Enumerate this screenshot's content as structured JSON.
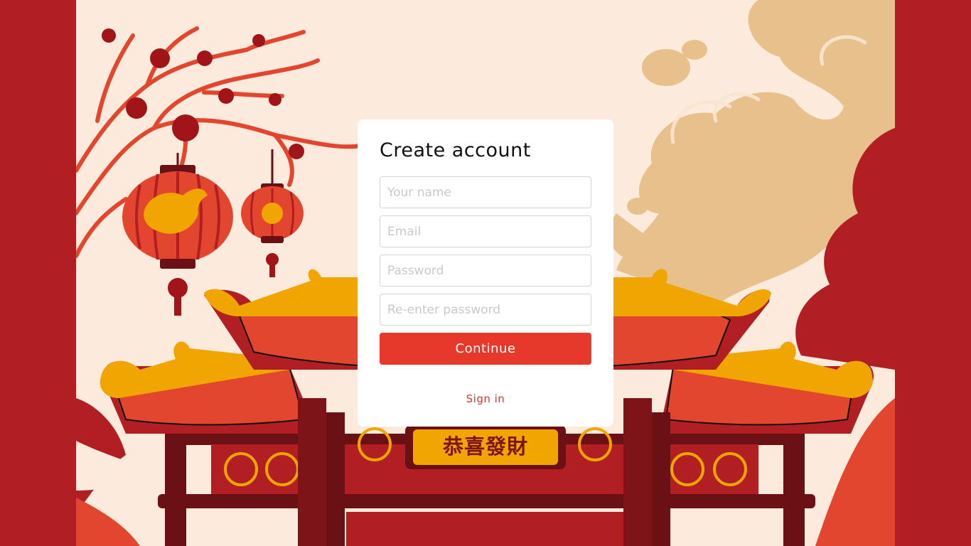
{
  "form": {
    "title": "Create account",
    "name_placeholder": "Your name",
    "email_placeholder": "Email",
    "password_placeholder": "Password",
    "repassword_placeholder": "Re-enter password",
    "continue_label": "Continue",
    "signin_label": "Sign in"
  },
  "gate": {
    "sign_text": "恭喜發財"
  },
  "colors": {
    "outer_red": "#b21f23",
    "cream": "#fcebdd",
    "cloud": "#e8c08c",
    "roof_red": "#e2462e",
    "roof_gold": "#f0a500",
    "dark_red": "#6b1014",
    "accent_button": "#e6392b"
  }
}
